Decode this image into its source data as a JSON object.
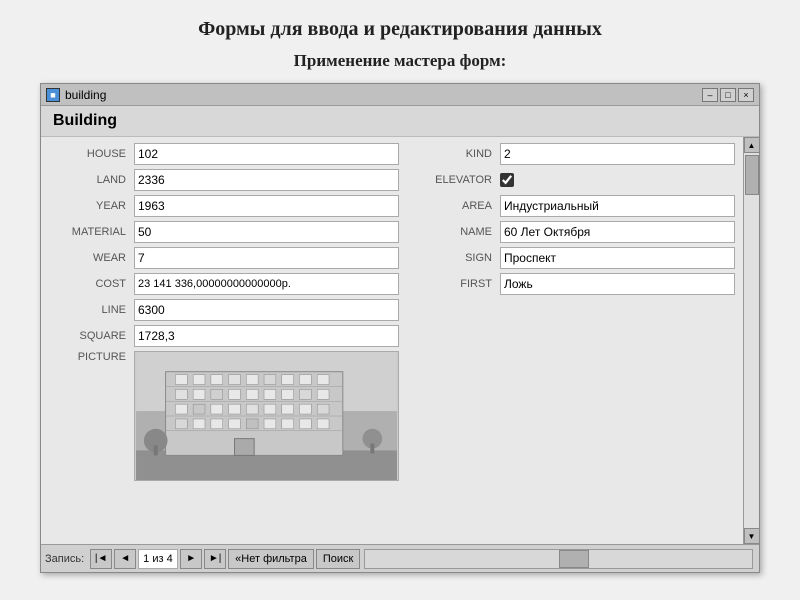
{
  "page": {
    "title_main": "Формы для ввода и редактирования данных",
    "title_sub": "Применение мастера форм:"
  },
  "window": {
    "title": "building",
    "icon_label": "■",
    "controls": {
      "minimize": "–",
      "restore": "□",
      "close": "×"
    },
    "form_header": "Building"
  },
  "fields_left": [
    {
      "label": "HOUSE",
      "value": "102"
    },
    {
      "label": "LAND",
      "value": "2336"
    },
    {
      "label": "YEAR",
      "value": "1963"
    },
    {
      "label": "MATERIAL",
      "value": "50"
    },
    {
      "label": "WEAR",
      "value": "7"
    },
    {
      "label": "COST",
      "value": "23 141 336,00000000000000р."
    },
    {
      "label": "LINE",
      "value": "6300"
    },
    {
      "label": "SQUARE",
      "value": "1728,3"
    },
    {
      "label": "PICTURE",
      "value": ""
    }
  ],
  "fields_right": [
    {
      "label": "KIND",
      "value": "2",
      "type": "text"
    },
    {
      "label": "ELEVATOR",
      "value": "checked",
      "type": "checkbox"
    },
    {
      "label": "AREA",
      "value": "Индустриальный",
      "type": "text"
    },
    {
      "label": "NAME",
      "value": "60 Лет Октября",
      "type": "text"
    },
    {
      "label": "SIGN",
      "value": "Проспект",
      "type": "text"
    },
    {
      "label": "FIRST",
      "value": "Ложь",
      "type": "text"
    }
  ],
  "status_bar": {
    "record_label": "Запись:",
    "nav_first": "|◄",
    "nav_prev": "◄",
    "record_info": "1 из 4",
    "nav_next": "►",
    "nav_last": "►|",
    "filter_label": "Нет фильтра",
    "search_label": "Поиск"
  }
}
